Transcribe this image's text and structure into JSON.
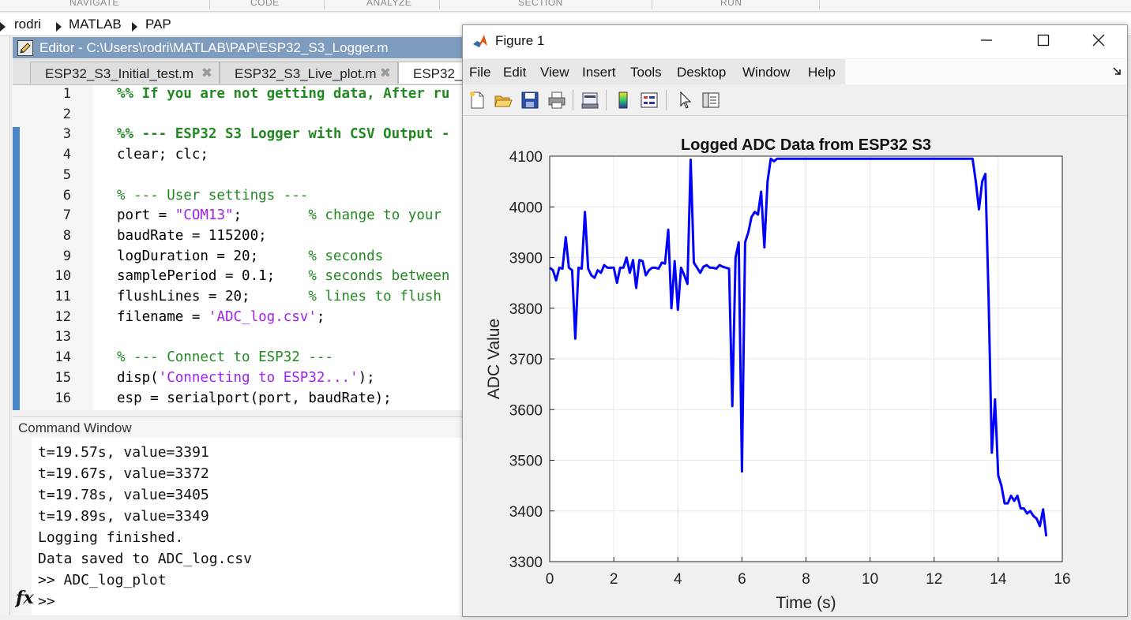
{
  "toolstrip": {
    "sections": [
      "NAVIGATE",
      "CODE",
      "ANALYZE",
      "SECTION",
      "RUN"
    ]
  },
  "address_bar": {
    "path": [
      "rodri",
      "MATLAB",
      "PAP"
    ]
  },
  "editor": {
    "title": "Editor - C:\\Users\\rodri\\MATLAB\\PAP\\ESP32_S3_Logger.m",
    "tabs": [
      {
        "label": "ESP32_S3_Initial_test.m",
        "active": false
      },
      {
        "label": "ESP32_S3_Live_plot.m",
        "active": false
      },
      {
        "label": "ESP32_S",
        "active": true
      }
    ],
    "close_glyph": "✖",
    "lines": [
      {
        "n": "1",
        "segs": [
          {
            "t": "%% If you are not getting data, After ru",
            "c": "cmb"
          }
        ]
      },
      {
        "n": "2",
        "segs": []
      },
      {
        "n": "3",
        "segs": [
          {
            "t": "%% --- ESP32 S3 Logger with CSV Output -",
            "c": "cmb"
          }
        ]
      },
      {
        "n": "4",
        "segs": [
          {
            "t": "clear; clc;",
            "c": ""
          }
        ]
      },
      {
        "n": "5",
        "segs": []
      },
      {
        "n": "6",
        "segs": [
          {
            "t": "% --- User settings ---",
            "c": "cm"
          }
        ]
      },
      {
        "n": "7",
        "segs": [
          {
            "t": "port = ",
            "c": ""
          },
          {
            "t": "\"COM13\"",
            "c": "st"
          },
          {
            "t": ";        ",
            "c": ""
          },
          {
            "t": "% change to your",
            "c": "cm"
          }
        ]
      },
      {
        "n": "8",
        "segs": [
          {
            "t": "baudRate = 115200;",
            "c": ""
          }
        ]
      },
      {
        "n": "9",
        "segs": [
          {
            "t": "logDuration = 20;      ",
            "c": ""
          },
          {
            "t": "% seconds",
            "c": "cm"
          }
        ]
      },
      {
        "n": "10",
        "segs": [
          {
            "t": "samplePeriod = 0.1;    ",
            "c": ""
          },
          {
            "t": "% seconds between",
            "c": "cm"
          }
        ]
      },
      {
        "n": "11",
        "segs": [
          {
            "t": "flushLines = 20;       ",
            "c": ""
          },
          {
            "t": "% lines to flush",
            "c": "cm"
          }
        ]
      },
      {
        "n": "12",
        "segs": [
          {
            "t": "filename = ",
            "c": ""
          },
          {
            "t": "'ADC_log.csv'",
            "c": "st"
          },
          {
            "t": ";",
            "c": ""
          }
        ]
      },
      {
        "n": "13",
        "segs": []
      },
      {
        "n": "14",
        "segs": [
          {
            "t": "% --- Connect to ESP32 ---",
            "c": "cm"
          }
        ]
      },
      {
        "n": "15",
        "segs": [
          {
            "t": "disp(",
            "c": ""
          },
          {
            "t": "'Connecting to ESP32...'",
            "c": "st"
          },
          {
            "t": ");",
            "c": ""
          }
        ]
      },
      {
        "n": "16",
        "segs": [
          {
            "t": "esp = serialport(port, baudRate);",
            "c": ""
          }
        ]
      }
    ],
    "right_edge_fragment": "a"
  },
  "command_window": {
    "title": "Command Window",
    "lines": [
      "t=19.57s, value=3391",
      "t=19.67s, value=3372",
      "t=19.78s, value=3405",
      "t=19.89s, value=3349",
      "Logging finished.",
      "Data saved to ADC_log.csv",
      ">> ADC_log_plot",
      ">>"
    ],
    "fx_label": "fx"
  },
  "figure": {
    "title": "Figure 1",
    "menus": [
      "File",
      "Edit",
      "View",
      "Insert",
      "Tools",
      "Desktop",
      "Window",
      "Help"
    ],
    "toolbar_icons": [
      "new-figure-icon",
      "open-file-icon",
      "save-icon",
      "print-icon",
      "link-plot-icon",
      "insert-colorbar-icon",
      "insert-legend-icon",
      "edit-plot-icon",
      "property-inspector-icon"
    ],
    "colors": {
      "line": "#0000ff",
      "grid": "#e6e6e6",
      "axes_bg": "#ffffff"
    }
  },
  "chart_data": {
    "type": "line",
    "title": "Logged ADC Data from ESP32 S3",
    "xlabel": "Time (s)",
    "ylabel": "ADC Value",
    "xlim": [
      0,
      16
    ],
    "ylim": [
      3300,
      4100
    ],
    "xticks": [
      0,
      2,
      4,
      6,
      8,
      10,
      12,
      14,
      16
    ],
    "yticks": [
      3300,
      3400,
      3500,
      3600,
      3700,
      3800,
      3900,
      4000,
      4100
    ],
    "grid": true,
    "series": [
      {
        "color": "#0000ff",
        "x": [
          0,
          0.1,
          0.2,
          0.3,
          0.4,
          0.5,
          0.6,
          0.7,
          0.8,
          0.9,
          1.0,
          1.1,
          1.2,
          1.3,
          1.4,
          1.5,
          1.6,
          1.7,
          1.8,
          1.9,
          2.0,
          2.1,
          2.2,
          2.3,
          2.4,
          2.5,
          2.6,
          2.7,
          2.8,
          2.9,
          3.0,
          3.1,
          3.2,
          3.3,
          3.4,
          3.5,
          3.6,
          3.7,
          3.8,
          3.9,
          4.0,
          4.1,
          4.2,
          4.3,
          4.4,
          4.5,
          4.6,
          4.7,
          4.8,
          4.9,
          5.0,
          5.1,
          5.2,
          5.3,
          5.4,
          5.5,
          5.6,
          5.7,
          5.8,
          5.9,
          6.0,
          6.1,
          6.2,
          6.3,
          6.4,
          6.5,
          6.6,
          6.7,
          6.8,
          6.9,
          7.0,
          7.1,
          7.2,
          8.0,
          9.0,
          10.0,
          11.0,
          12.0,
          13.0,
          13.2,
          13.3,
          13.4,
          13.5,
          13.6,
          13.7,
          13.8,
          13.9,
          14.0,
          14.1,
          14.2,
          14.3,
          14.4,
          14.5,
          14.6,
          14.7,
          14.8,
          14.9,
          15.0,
          15.1,
          15.2,
          15.3,
          15.4,
          15.5
        ],
        "y": [
          3880,
          3875,
          3855,
          3880,
          3878,
          3940,
          3880,
          3875,
          3740,
          3880,
          3878,
          3990,
          3878,
          3865,
          3860,
          3875,
          3870,
          3885,
          3880,
          3880,
          3880,
          3850,
          3880,
          3880,
          3900,
          3870,
          3895,
          3840,
          3895,
          3893,
          3865,
          3875,
          3880,
          3880,
          3878,
          3890,
          3888,
          3955,
          3800,
          3893,
          3797,
          3880,
          3865,
          3848,
          4093,
          3890,
          3880,
          3870,
          3882,
          3885,
          3880,
          3880,
          3878,
          3885,
          3882,
          3880,
          3878,
          3607,
          3900,
          3930,
          3478,
          3930,
          3950,
          3980,
          3990,
          3985,
          4030,
          3920,
          4050,
          4095,
          4090,
          4095,
          4095,
          4095,
          4095,
          4095,
          4095,
          4095,
          4095,
          4095,
          4050,
          3995,
          4050,
          4065,
          3820,
          3515,
          3620,
          3470,
          3450,
          3415,
          3415,
          3430,
          3420,
          3430,
          3405,
          3405,
          3395,
          3400,
          3390,
          3385,
          3370,
          3403,
          3350
        ]
      }
    ]
  }
}
